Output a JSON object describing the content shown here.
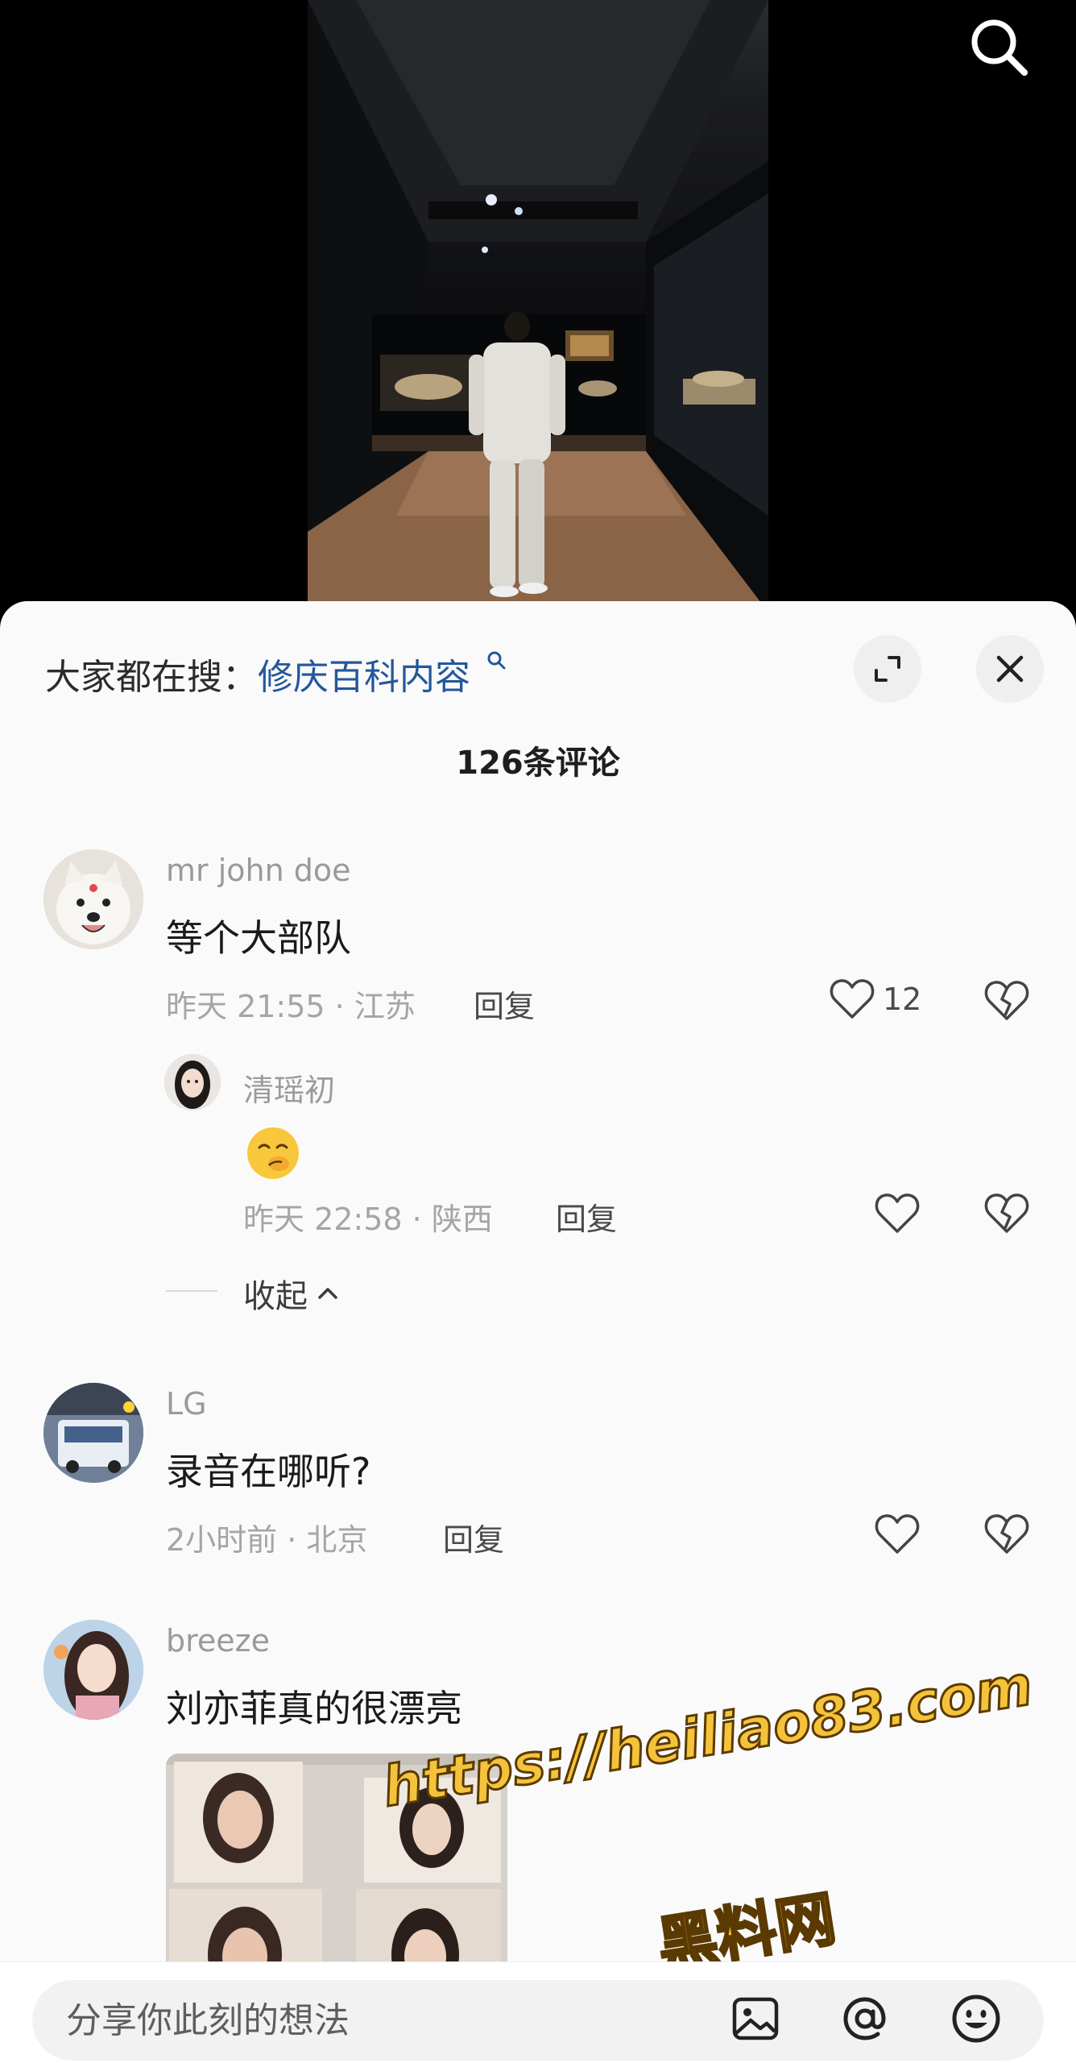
{
  "hot_search": {
    "prefix": "大家都在搜：",
    "keyword": "修庆百科内容"
  },
  "comments_count": "126条评论",
  "comments": [
    {
      "username": "mr john doe",
      "text": "等个大部队",
      "meta": "昨天 21:55 · 江苏",
      "reply_label": "回复",
      "likes": "12"
    },
    {
      "username": "LG",
      "text": "录音在哪听?",
      "meta": "2小时前 · 北京",
      "reply_label": "回复"
    },
    {
      "username": "breeze",
      "text": "刘亦菲真的很漂亮"
    }
  ],
  "reply": {
    "username": "清瑶初",
    "meta": "昨天 22:58 · 陕西",
    "reply_label": "回复"
  },
  "collapse_label": "收起",
  "input": {
    "placeholder": "分享你此刻的想法"
  },
  "watermark": {
    "url": "https://heiliao83.com",
    "name": "黑料网"
  },
  "colors": {
    "accent_link": "#22579c",
    "sheet_bg": "#fafafa",
    "watermark": "#f5c33b"
  },
  "icons": [
    "search-icon",
    "expand-icon",
    "close-icon",
    "heart-icon",
    "broken-heart-icon",
    "chevron-up-icon",
    "image-icon",
    "at-icon",
    "smiley-icon"
  ]
}
